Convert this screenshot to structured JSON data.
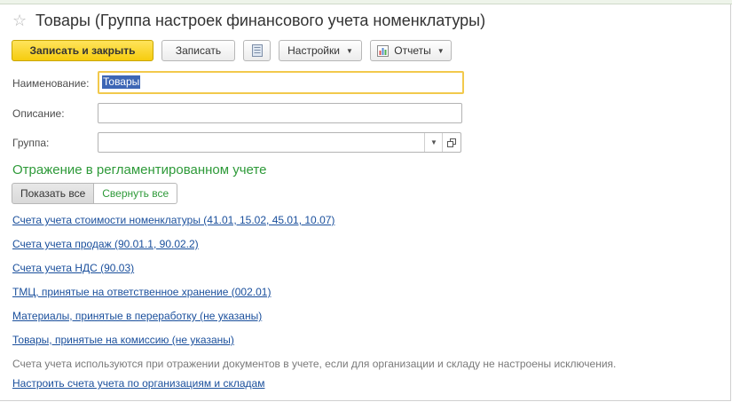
{
  "window": {
    "title": "Товары (Группа настроек финансового учета номенклатуры)"
  },
  "toolbar": {
    "save_close_label": "Записать и закрыть",
    "save_label": "Записать",
    "settings_label": "Настройки",
    "reports_label": "Отчеты"
  },
  "form": {
    "name_label": "Наименование:",
    "name_value": "Товары",
    "description_label": "Описание:",
    "description_value": "",
    "group_label": "Группа:",
    "group_value": ""
  },
  "section": {
    "title": "Отражение в регламентированном учете",
    "show_all_label": "Показать все",
    "collapse_all_label": "Свернуть все"
  },
  "links": [
    "Счета учета стоимости номенклатуры (41.01, 15.02, 45.01, 10.07)",
    "Счета учета продаж (90.01.1, 90.02.2)",
    "Счета учета НДС (90.03)",
    "ТМЦ, принятые на ответственное хранение (002.01)",
    "Материалы, принятые в переработку (не указаны)",
    "Товары, принятые на комиссию (не указаны)"
  ],
  "hint": "Счета учета используются при отражении документов в учете, если для организации и складу не настроены исключения.",
  "configure_link": "Настроить счета учета по организациям и складам",
  "colors": {
    "primary_button": "#f6cc0e",
    "section_title": "#2e9a39",
    "link": "#1a4f9c",
    "focus_border": "#f2c94c",
    "selection": "#3d66b5"
  },
  "icons": {
    "favorite": "star-icon",
    "list": "list-icon",
    "reports": "chart-icon",
    "dropdown": "chevron-down-icon",
    "open": "open-window-icon"
  }
}
